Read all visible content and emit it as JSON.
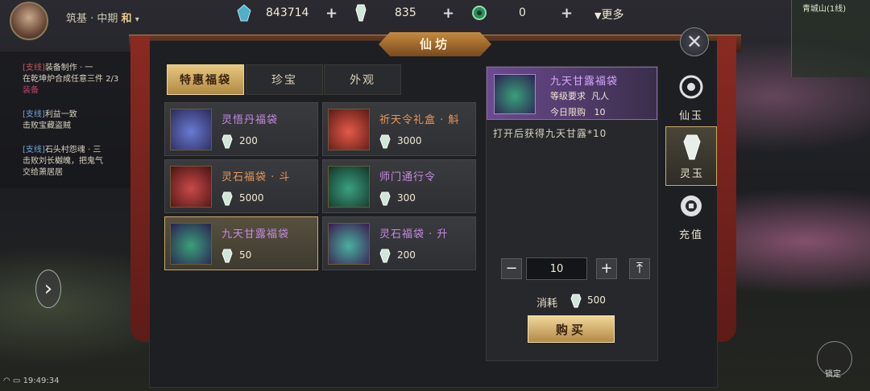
{
  "topbar": {
    "rank": "筑基 · 中期",
    "rank_extra": "和",
    "jade_blue": "843714",
    "jade_white": "835",
    "jade_green": "0",
    "more": "更多"
  },
  "tasks": [
    {
      "tag": "[支线]",
      "title": "装备制作 · 一",
      "lines": [
        "在乾坤炉合成任意三件",
        "装备"
      ],
      "progress": "2/3"
    },
    {
      "tag": "[支线]",
      "title": "利益一致",
      "lines": [
        "击败宝藏盗贼"
      ]
    },
    {
      "tag": "[支线]",
      "title": "石头村怨魂 · 三",
      "lines": [
        "击败刘长樾魄，把鬼气",
        "交给萧居居"
      ]
    }
  ],
  "window": {
    "title": "仙坊",
    "close": "✕"
  },
  "tabs": [
    {
      "label": "特惠福袋",
      "active": true
    },
    {
      "label": "珍宝",
      "active": false
    },
    {
      "label": "外观",
      "active": false
    }
  ],
  "items": [
    {
      "name": "灵悟丹福袋",
      "price": "200",
      "color": "purple",
      "thumb": "#3b3a6e"
    },
    {
      "name": "祈天令礼盒 · 斛",
      "price": "3000",
      "color": "orange",
      "thumb": "#7a2a22"
    },
    {
      "name": "灵石福袋 · 斗",
      "price": "5000",
      "color": "orange",
      "thumb": "#5a1e1e"
    },
    {
      "name": "师门通行令",
      "price": "300",
      "color": "purple",
      "thumb": "#1f4a3a"
    },
    {
      "name": "九天甘露福袋",
      "price": "50",
      "color": "purple",
      "thumb": "#3d3360",
      "selected": true
    },
    {
      "name": "灵石福袋 · 升",
      "price": "200",
      "color": "purple",
      "thumb": "#4a3060"
    }
  ],
  "detail": {
    "name": "九天甘露福袋",
    "level_req_label": "等级要求",
    "level_req_value": "凡人",
    "limit_label": "今日限购",
    "limit_value": "10",
    "desc": "打开后获得九天甘露*10",
    "quantity": "10",
    "cost_label": "消耗",
    "cost_value": "500",
    "buy": "购买"
  },
  "side_tabs": [
    {
      "label": "仙玉",
      "active": false
    },
    {
      "label": "灵玉",
      "active": true
    },
    {
      "label": "充值",
      "active": false
    }
  ],
  "hud": {
    "minimap_title": "青城山(1线)",
    "status_time": "19:49:34",
    "lock_label": "锁定"
  }
}
